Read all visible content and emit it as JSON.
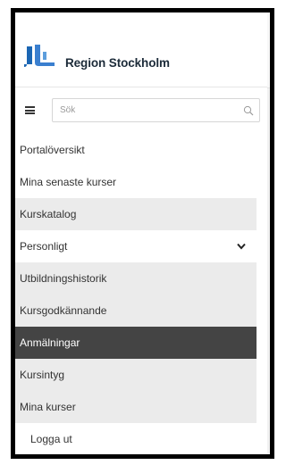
{
  "logo": {
    "text": "Region Stockholm",
    "colors": [
      "#1b66b3",
      "#5c9ddc"
    ]
  },
  "search": {
    "placeholder": "Sök"
  },
  "menu": {
    "items": [
      {
        "label": "Portalöversikt"
      },
      {
        "label": "Mina senaste kurser"
      },
      {
        "label": "Kurskatalog"
      },
      {
        "label": "Personligt"
      },
      {
        "label": "Utbildningshistorik"
      },
      {
        "label": "Kursgodkännande"
      },
      {
        "label": "Anmälningar"
      },
      {
        "label": "Kursintyg"
      },
      {
        "label": "Mina kurser"
      },
      {
        "label": "Logga ut"
      }
    ]
  },
  "colors": {
    "active_bg": "#444444",
    "shade_bg": "#ebebeb",
    "border": "#000000"
  },
  "icons": [
    "hamburger-icon",
    "search-icon",
    "chevron-down-icon"
  ]
}
